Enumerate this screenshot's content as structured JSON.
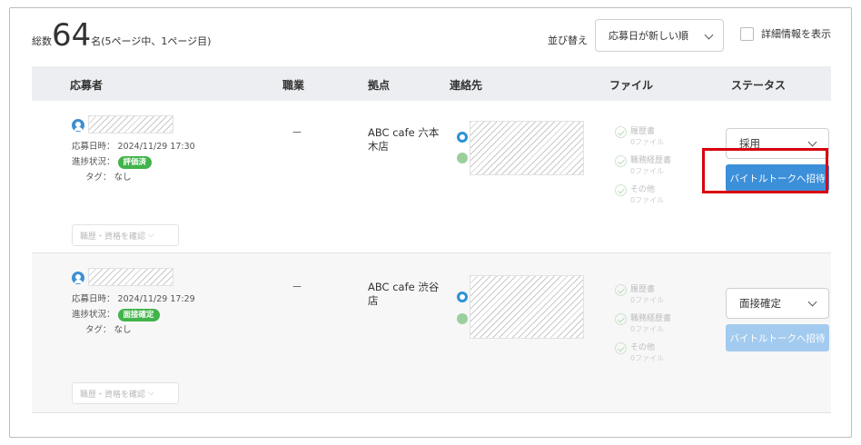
{
  "header": {
    "total_label": "総数",
    "total_count": "64",
    "total_suffix": "名(5ページ中、1ページ目)",
    "sort_label": "並び替え",
    "sort_selected": "応募日が新しい順",
    "detail_toggle_label": "詳細情報を表示"
  },
  "table": {
    "columns": [
      "応募者",
      "職業",
      "拠点",
      "連絡先",
      "ファイル",
      "ステータス"
    ]
  },
  "rows": [
    {
      "applied_label": "応募日時",
      "applied_at": "2024/11/29 17:30",
      "progress_label": "進捗状況",
      "progress_badge": "評価済",
      "tag_label": "タグ",
      "tag_value": "なし",
      "resume_button": "職歴・資格を確認",
      "occupation": "－",
      "site": "ABC cafe 六本木店",
      "files": [
        {
          "name": "履歴書",
          "count": "0ファイル"
        },
        {
          "name": "職務経歴書",
          "count": "0ファイル"
        },
        {
          "name": "その他",
          "count": "0ファイル"
        }
      ],
      "status": "採用",
      "invite_button": "バイトルトークへ招待"
    },
    {
      "applied_label": "応募日時",
      "applied_at": "2024/11/29 17:29",
      "progress_label": "進捗状況",
      "progress_badge": "面接確定",
      "tag_label": "タグ",
      "tag_value": "なし",
      "resume_button": "職歴・資格を確認",
      "occupation": "－",
      "site": "ABC cafe 渋谷店",
      "files": [
        {
          "name": "履歴書",
          "count": "0ファイル"
        },
        {
          "name": "職務経歴書",
          "count": "0ファイル"
        },
        {
          "name": "その他",
          "count": "0ファイル"
        }
      ],
      "status": "面接確定",
      "invite_button": "バイトルトークへ招待"
    }
  ],
  "colors": {
    "badge_green": "#41b34a",
    "invite_active": "#3c8fd9",
    "invite_disabled": "#a3cbef",
    "highlight_red": "#d9000d",
    "header_bg": "#eceef1"
  }
}
